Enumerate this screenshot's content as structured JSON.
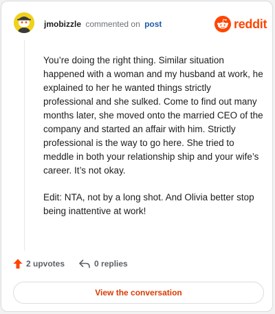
{
  "header": {
    "username": "jmobizzle",
    "action_text": "commented on",
    "post_link": "post",
    "brand_name": "reddit",
    "brand_color": "#ff4500"
  },
  "comment": {
    "paragraphs": [
      "You’re doing the right thing. Similar situation happened with a woman and my husband at work, he explained to her he wanted things strictly professional and she sulked. Come to find out many months later, she moved onto the married CEO of the company and started an affair with him. Strictly professional is the way to go here. She tried to meddle in both your relationship ship and your wife’s career. It’s not okay.",
      "Edit: NTA, not by a long shot. And Olivia better stop being inattentive at work!"
    ]
  },
  "stats": {
    "upvotes": "2 upvotes",
    "replies": "0 replies",
    "upvote_icon": "upvote-arrow-icon",
    "reply_icon": "reply-arrow-icon"
  },
  "cta": {
    "label": "View the conversation",
    "color": "#d93a00"
  },
  "avatar": {
    "icon": "snoo-avatar-icon",
    "color": "#f0d21d"
  }
}
